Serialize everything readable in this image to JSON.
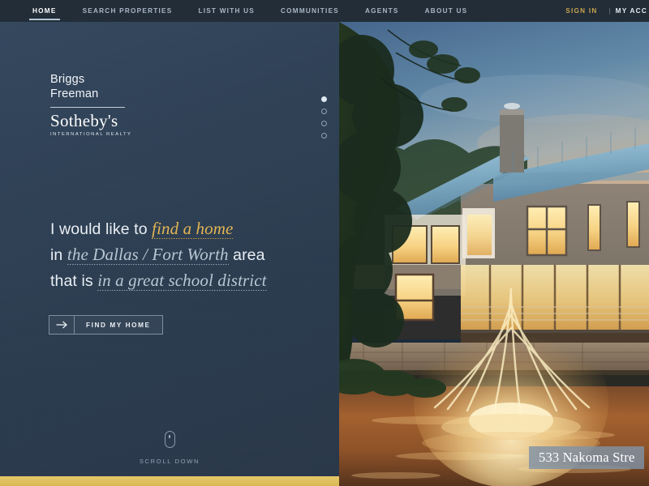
{
  "nav": {
    "items": [
      {
        "label": "HOME",
        "active": true
      },
      {
        "label": "SEARCH PROPERTIES",
        "active": false
      },
      {
        "label": "LIST WITH US",
        "active": false
      },
      {
        "label": "COMMUNITIES",
        "active": false
      },
      {
        "label": "AGENTS",
        "active": false
      },
      {
        "label": "ABOUT US",
        "active": false
      }
    ],
    "sign_in": "SIGN IN",
    "separator": "|",
    "my_account": "MY ACC",
    "active_color": "#ffffff",
    "link_color": "#a9b6c4",
    "signin_color": "#c9a44c",
    "bar_color": "#222d38"
  },
  "logo": {
    "line1": "Briggs",
    "line2": "Freeman",
    "brand": "Sotheby's",
    "tagline": "INTERNATIONAL REALTY"
  },
  "carousel": {
    "dots": [
      {
        "index": 1,
        "active": true
      },
      {
        "index": 2,
        "active": false
      },
      {
        "index": 3,
        "active": false
      },
      {
        "index": 4,
        "active": false
      }
    ]
  },
  "headline": {
    "part1": "I would like to ",
    "slot1": "find a home",
    "part2": "in ",
    "slot2": "the Dallas / Fort Worth",
    "part3": " area",
    "part4": "that is ",
    "slot3": "in a great school district",
    "slot1_color": "#e3b552",
    "slot_gray_color": "#b9c6d3"
  },
  "cta": {
    "label": "FIND MY HOME",
    "icon": "arrow-right-icon"
  },
  "scroll": {
    "label": "SCROLL DOWN",
    "icon": "mouse-icon"
  },
  "hero": {
    "caption": "533 Nakoma Stre",
    "alt": "Dusk photo of a modern farmhouse with a blue standing-seam metal roof, warmly lit windows, and an illuminated fountain in a pond"
  },
  "theme": {
    "panel_bg": "#2e4055",
    "gold": "#e6c76a",
    "text_light": "#e9eef3"
  }
}
